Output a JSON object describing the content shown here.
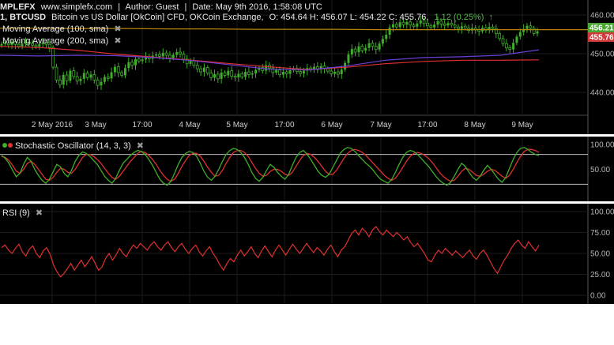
{
  "header": {
    "logo": "MPLEFX",
    "site": "www.simplefx.com",
    "author": "Author: Guest",
    "date": "Date: May 9th 2016, 1:58:08 UTC",
    "symbol": "1, BTCUSD",
    "description": "Bitcoin vs US Dollar [OkCoin] CFD, OKCoin Exchange,",
    "ohlc": "O: 454.64 H: 456.07 L: 454.22 C: 455.76,",
    "change": "1.12 (0.25%)",
    "change_arrow": "↑",
    "separator": "|"
  },
  "legend": [
    {
      "label": "Moving Average (100, sma)",
      "close": "✖"
    },
    {
      "label": "Moving Average (200, sma)",
      "close": "✖"
    }
  ],
  "price_badges": {
    "ma100": "456.21",
    "last": "455.76"
  },
  "indicators": {
    "stoch": {
      "label": "Stochastic Oscillator (14, 3, 3)",
      "close": "✖"
    },
    "rsi": {
      "label": "RSI (9)",
      "close": "✖"
    }
  },
  "colors": {
    "bg": "#000000",
    "up": "#3fae2a",
    "down": "#3fae2a",
    "ma100": "#b8860b",
    "ma200": "#e03030",
    "ma_purple": "#6a3fd6",
    "stoch_k": "#3fae2a",
    "stoch_d": "#e03030",
    "rsi": "#e03030",
    "badge_green": "#4aa832",
    "badge_red": "#d03a3a",
    "header_change": "#55b84a"
  },
  "chart_data": [
    {
      "type": "candlestick",
      "symbol": "BTCUSD",
      "y_ticks": [
        "460.00",
        "450.00",
        "440.00"
      ],
      "ylim": [
        434,
        462
      ],
      "x_ticks": [
        "2 May 2016",
        "3 May",
        "17:00",
        "4 May",
        "5 May",
        "17:00",
        "6 May",
        "7 May",
        "17:00",
        "8 May",
        "9 May"
      ],
      "close_series": [
        452.5,
        452.8,
        452.3,
        453.1,
        452.4,
        451.9,
        452.6,
        453.0,
        452.7,
        452.2,
        451.8,
        452.5,
        452.9,
        452.4,
        451.6,
        446.5,
        443.2,
        442.0,
        444.5,
        443.0,
        445.6,
        444.1,
        442.9,
        443.5,
        445.0,
        443.8,
        444.6,
        443.2,
        441.8,
        442.7,
        444.0,
        443.6,
        445.2,
        446.6,
        445.1,
        444.4,
        446.3,
        447.8,
        447.0,
        448.6,
        448.1,
        448.5,
        449.2,
        448.7,
        449.5,
        449.8,
        449.3,
        450.2,
        449.6,
        448.9,
        449.7,
        450.4,
        449.9,
        448.6,
        447.4,
        448.2,
        447.0,
        446.1,
        445.3,
        446.4,
        445.0,
        443.8,
        444.7,
        443.5,
        445.1,
        444.4,
        445.6,
        444.2,
        443.9,
        444.8,
        444.0,
        445.3,
        444.6,
        444.9,
        445.8,
        446.4,
        445.6,
        447.0,
        446.3,
        445.1,
        445.8,
        444.6,
        445.3,
        444.8,
        445.7,
        446.2,
        445.4,
        444.9,
        445.6,
        446.3,
        445.8,
        446.6,
        445.9,
        446.8,
        446.1,
        445.5,
        444.8,
        445.3,
        444.7,
        445.9,
        447.6,
        449.8,
        451.2,
        450.4,
        451.9,
        450.8,
        451.5,
        452.7,
        451.9,
        451.1,
        452.6,
        453.8,
        454.9,
        456.8,
        457.6,
        456.9,
        458.1,
        457.5,
        458.2,
        457.4,
        457.0,
        457.8,
        458.6,
        457.9,
        457.2,
        456.8,
        457.5,
        458.4,
        457.7,
        457.3,
        457.9,
        457.4,
        456.9,
        456.4,
        457.1,
        456.6,
        456.0,
        456.6,
        456.2,
        455.8,
        456.7,
        456.1,
        456.9,
        456.5,
        455.2,
        453.9,
        452.6,
        451.5,
        451.1,
        452.8,
        454.4,
        455.6,
        456.4,
        457.2,
        456.6,
        455.2,
        455.8
      ],
      "ma100": [
        456.6,
        456.6,
        456.5,
        456.5,
        456.4,
        456.4,
        456.3,
        456.3,
        456.3,
        456.2,
        456.2,
        456.2,
        456.2,
        456.2,
        456.2
      ],
      "ma200": [
        451.9,
        451.6,
        450.9,
        449.9,
        449.1,
        448.3,
        447.4,
        446.6,
        445.9,
        446.5,
        447.4,
        448.0,
        448.3,
        448.3,
        448.4
      ],
      "ma_purple": [
        449.6,
        449.4,
        449.6,
        449.5,
        449.0,
        448.2,
        447.1,
        446.0,
        445.8,
        446.8,
        448.3,
        449.0,
        449.2,
        449.6,
        451.0
      ]
    },
    {
      "type": "line",
      "name": "Stochastic Oscillator (14, 3, 3)",
      "y_ticks": [
        "100.00",
        "50.00"
      ],
      "ylim": [
        0,
        100
      ],
      "levels": [
        80,
        20
      ],
      "k": [
        78,
        72,
        62,
        48,
        35,
        42,
        60,
        74,
        66,
        50,
        38,
        28,
        22,
        30,
        45,
        60,
        55,
        42,
        35,
        48,
        66,
        78,
        85,
        82,
        76,
        68,
        60,
        48,
        36,
        28,
        22,
        32,
        48,
        62,
        70,
        78,
        84,
        88,
        86,
        80,
        70,
        58,
        44,
        30,
        22,
        18,
        26,
        42,
        60,
        74,
        82,
        86,
        84,
        76,
        62,
        46,
        34,
        28,
        36,
        50,
        66,
        80,
        88,
        92,
        90,
        84,
        74,
        60,
        44,
        32,
        26,
        34,
        48,
        60,
        54,
        44,
        36,
        30,
        40,
        58,
        74,
        84,
        88,
        80,
        70,
        58,
        46,
        38,
        34,
        40,
        54,
        68,
        82,
        90,
        94,
        92,
        86,
        78,
        70,
        62,
        56,
        48,
        38,
        30,
        26,
        22,
        30,
        44,
        60,
        74,
        84,
        88,
        86,
        80,
        72,
        64,
        56,
        46,
        36,
        28,
        22,
        18,
        24,
        36,
        50,
        62,
        56,
        44,
        34,
        28,
        36,
        48,
        58,
        50,
        40,
        30,
        24,
        34,
        52,
        70,
        84,
        92,
        94,
        90,
        84,
        80,
        78
      ],
      "d": [
        76,
        74,
        68,
        58,
        46,
        42,
        50,
        62,
        66,
        60,
        50,
        40,
        30,
        28,
        34,
        44,
        52,
        50,
        44,
        42,
        50,
        62,
        74,
        80,
        80,
        76,
        70,
        62,
        52,
        42,
        34,
        30,
        36,
        46,
        56,
        66,
        74,
        82,
        86,
        84,
        78,
        70,
        60,
        48,
        38,
        30,
        26,
        30,
        42,
        56,
        68,
        78,
        82,
        82,
        76,
        66,
        54,
        44,
        36,
        38,
        48,
        62,
        74,
        84,
        88,
        88,
        84,
        76,
        64,
        52,
        42,
        36,
        38,
        46,
        50,
        50,
        46,
        40,
        38,
        44,
        56,
        68,
        78,
        82,
        80,
        74,
        66,
        56,
        46,
        40,
        40,
        48,
        60,
        72,
        82,
        88,
        90,
        88,
        84,
        78,
        70,
        62,
        54,
        46,
        38,
        32,
        28,
        32,
        42,
        54,
        66,
        76,
        82,
        84,
        82,
        78,
        72,
        64,
        54,
        44,
        36,
        30,
        26,
        28,
        36,
        46,
        52,
        50,
        44,
        38,
        36,
        40,
        46,
        50,
        48,
        42,
        36,
        32,
        38,
        50,
        64,
        76,
        86,
        90,
        90,
        88,
        84
      ]
    },
    {
      "type": "line",
      "name": "RSI (9)",
      "y_ticks": [
        "100.00",
        "75.00",
        "50.00",
        "25.00",
        "0.00"
      ],
      "ylim": [
        0,
        100
      ],
      "values": [
        57,
        60,
        54,
        50,
        56,
        61,
        52,
        47,
        55,
        59,
        50,
        45,
        53,
        57,
        49,
        36,
        28,
        22,
        26,
        32,
        38,
        30,
        36,
        42,
        34,
        40,
        46,
        38,
        30,
        34,
        44,
        50,
        42,
        48,
        56,
        50,
        46,
        54,
        60,
        56,
        62,
        58,
        54,
        60,
        64,
        58,
        54,
        60,
        64,
        57,
        52,
        58,
        62,
        55,
        50,
        56,
        60,
        52,
        47,
        53,
        58,
        50,
        44,
        36,
        30,
        38,
        44,
        40,
        48,
        54,
        47,
        52,
        58,
        50,
        45,
        53,
        59,
        52,
        46,
        54,
        60,
        54,
        48,
        55,
        61,
        55,
        50,
        56,
        62,
        56,
        51,
        57,
        53,
        48,
        55,
        60,
        52,
        46,
        54,
        58,
        66,
        74,
        78,
        72,
        80,
        76,
        70,
        78,
        82,
        76,
        72,
        78,
        74,
        70,
        75,
        71,
        66,
        70,
        63,
        58,
        62,
        56,
        50,
        42,
        40,
        48,
        54,
        50,
        56,
        52,
        48,
        53,
        49,
        45,
        50,
        54,
        47,
        43,
        50,
        54,
        48,
        40,
        32,
        26,
        34,
        42,
        48,
        56,
        62,
        66,
        60,
        56,
        64,
        58,
        53,
        60
      ]
    }
  ]
}
